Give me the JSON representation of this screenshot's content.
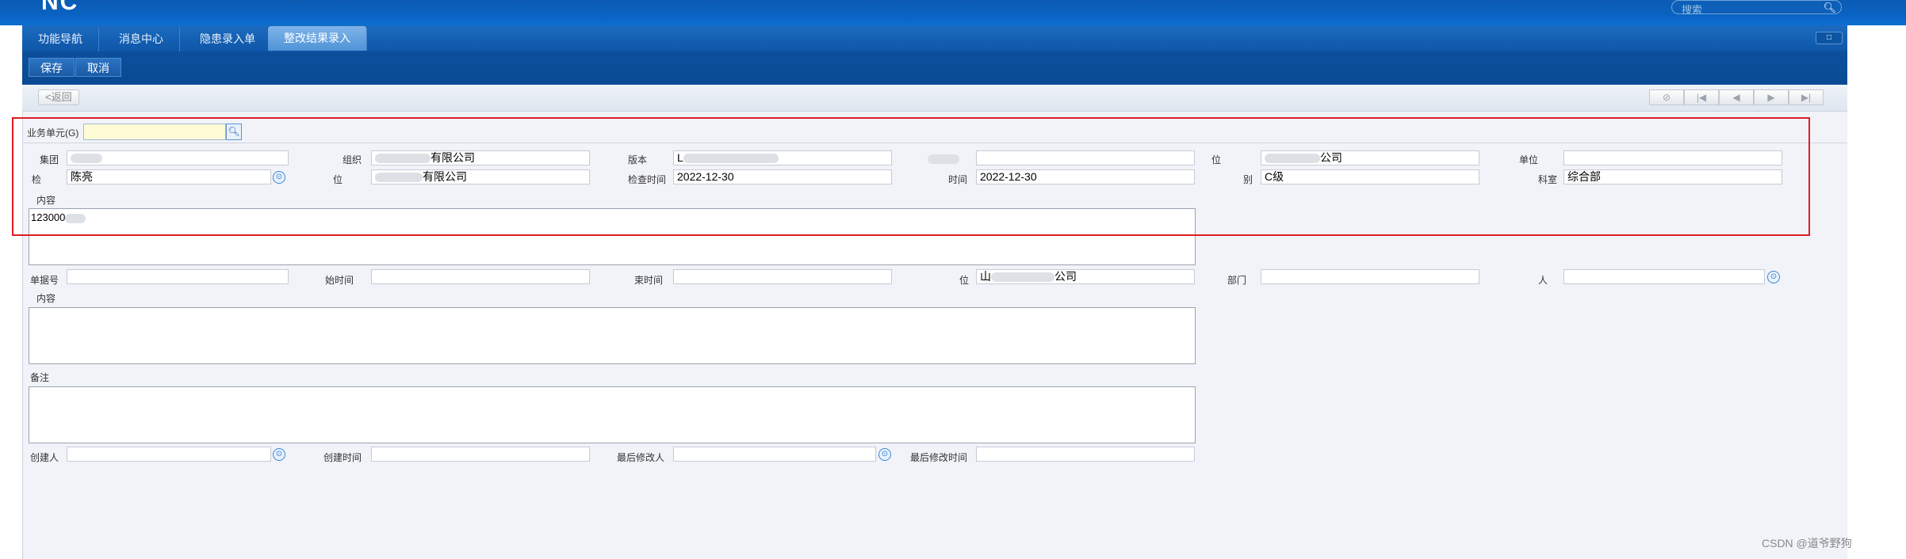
{
  "app": {
    "logo_text": "NC",
    "search_placeholder": "搜索",
    "window_button": "□"
  },
  "tabs": [
    {
      "label": "功能导航"
    },
    {
      "label": "消息中心"
    },
    {
      "label": "隐患录入单"
    },
    {
      "label": "整改结果录入",
      "active": true
    }
  ],
  "toolbar": {
    "save_label": "保存",
    "cancel_label": "取消"
  },
  "subbar": {
    "back_label": "<返回",
    "nav": [
      "⊘",
      "|◀",
      "◀",
      "▶",
      "▶|"
    ]
  },
  "form": {
    "business_unit_label": "业务单元(G)",
    "business_unit_value": "",
    "row1": {
      "group_label": "集团",
      "org_label": "组织",
      "org_value": "有限公司",
      "version_label": "版本",
      "version_value": "L",
      "location_value": "",
      "unit_label": "位",
      "unit_value": "公司",
      "unit2_label": "单位",
      "unit2_value": ""
    },
    "row2": {
      "inspector_label": "检",
      "inspector_value": "陈亮",
      "inspect_unit_label": "位",
      "inspect_unit_value": "有限公司",
      "inspect_time_label": "检查时间",
      "inspect_time_value": "2022-12-30",
      "other_time_label": "时间",
      "other_time_value": "2022-12-30",
      "level_label": "别",
      "level_value": "C级",
      "office_label": "科室",
      "office_value": "综合部"
    },
    "content_label": "内容",
    "content_value": "123000",
    "row3": {
      "bill_no_label": "单据号",
      "bill_no_value": "",
      "start_time_label": "始时间",
      "start_time_value": "",
      "end_time_label": "束时间",
      "end_time_value": "",
      "rect_unit_label": "位",
      "rect_unit_value": "山",
      "rect_unit_value_tail": "公司",
      "dept_label": "部门",
      "dept_value": "",
      "person_label": "人",
      "person_value": ""
    },
    "rect_content_label": "内容",
    "remark_label": "备注",
    "row4": {
      "creator_label": "创建人",
      "creator_value": "",
      "created_time_label": "创建时间",
      "created_time_value": "",
      "modifier_label": "最后修改人",
      "modifier_value": "",
      "modified_time_label": "最后修改时间",
      "modified_time_value": ""
    }
  },
  "watermark": "CSDN @道爷野狗"
}
